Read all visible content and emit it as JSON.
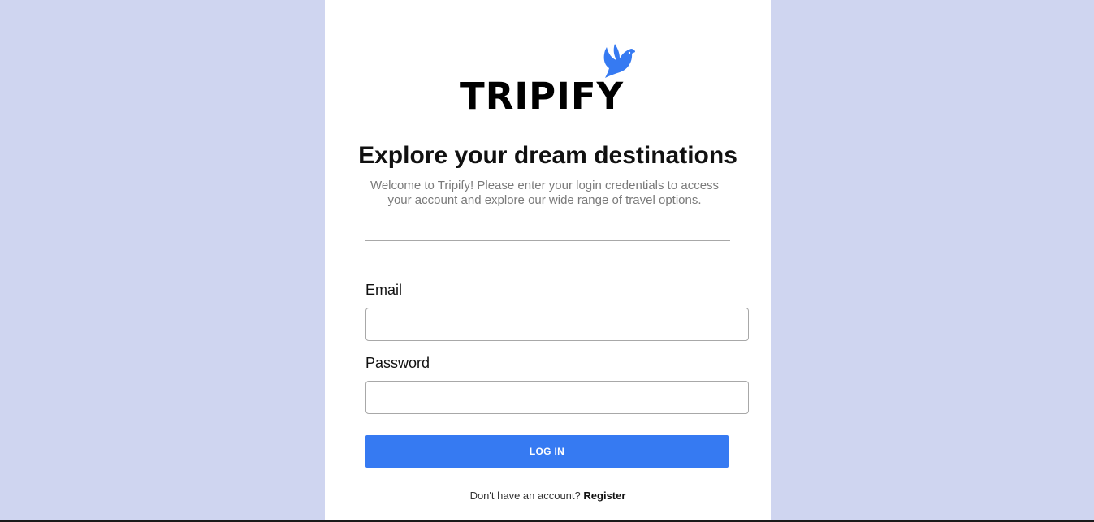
{
  "brand": {
    "name": "TRIPIFY",
    "logo_icon": "dove-icon",
    "accent_color": "#367af2"
  },
  "hero": {
    "title": "Explore your dream destinations",
    "subtitle": "Welcome to Tripify! Please enter your login credentials to access your account and explore our wide range of travel options."
  },
  "form": {
    "email_label": "Email",
    "email_value": "",
    "password_label": "Password",
    "password_value": "",
    "login_button_label": "LOG IN"
  },
  "footer": {
    "prompt_text": "Don't have an account?",
    "register_label": "Register"
  },
  "colors": {
    "page_background": "#cfd5f0",
    "card_background": "#ffffff",
    "button_background": "#367af2"
  }
}
